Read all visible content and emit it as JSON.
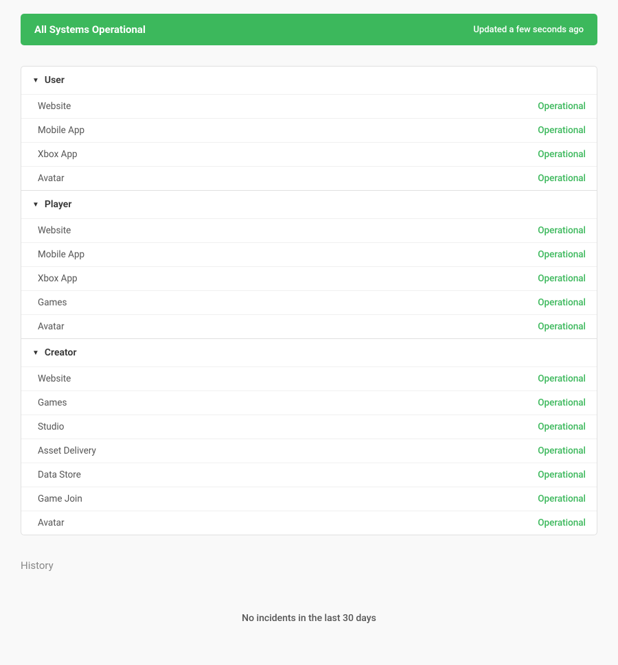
{
  "banner": {
    "title": "All Systems Operational",
    "updated": "Updated a few seconds ago",
    "bg_color": "#3cb85c"
  },
  "categories": [
    {
      "name": "User",
      "items": [
        {
          "name": "Website",
          "status": "Operational"
        },
        {
          "name": "Mobile App",
          "status": "Operational"
        },
        {
          "name": "Xbox App",
          "status": "Operational"
        },
        {
          "name": "Avatar",
          "status": "Operational"
        }
      ]
    },
    {
      "name": "Player",
      "items": [
        {
          "name": "Website",
          "status": "Operational"
        },
        {
          "name": "Mobile App",
          "status": "Operational"
        },
        {
          "name": "Xbox App",
          "status": "Operational"
        },
        {
          "name": "Games",
          "status": "Operational"
        },
        {
          "name": "Avatar",
          "status": "Operational"
        }
      ]
    },
    {
      "name": "Creator",
      "items": [
        {
          "name": "Website",
          "status": "Operational"
        },
        {
          "name": "Games",
          "status": "Operational"
        },
        {
          "name": "Studio",
          "status": "Operational"
        },
        {
          "name": "Asset Delivery",
          "status": "Operational"
        },
        {
          "name": "Data Store",
          "status": "Operational"
        },
        {
          "name": "Game Join",
          "status": "Operational"
        },
        {
          "name": "Avatar",
          "status": "Operational"
        }
      ]
    }
  ],
  "history": {
    "title": "History",
    "no_incidents": "No incidents in the last 30 days"
  }
}
